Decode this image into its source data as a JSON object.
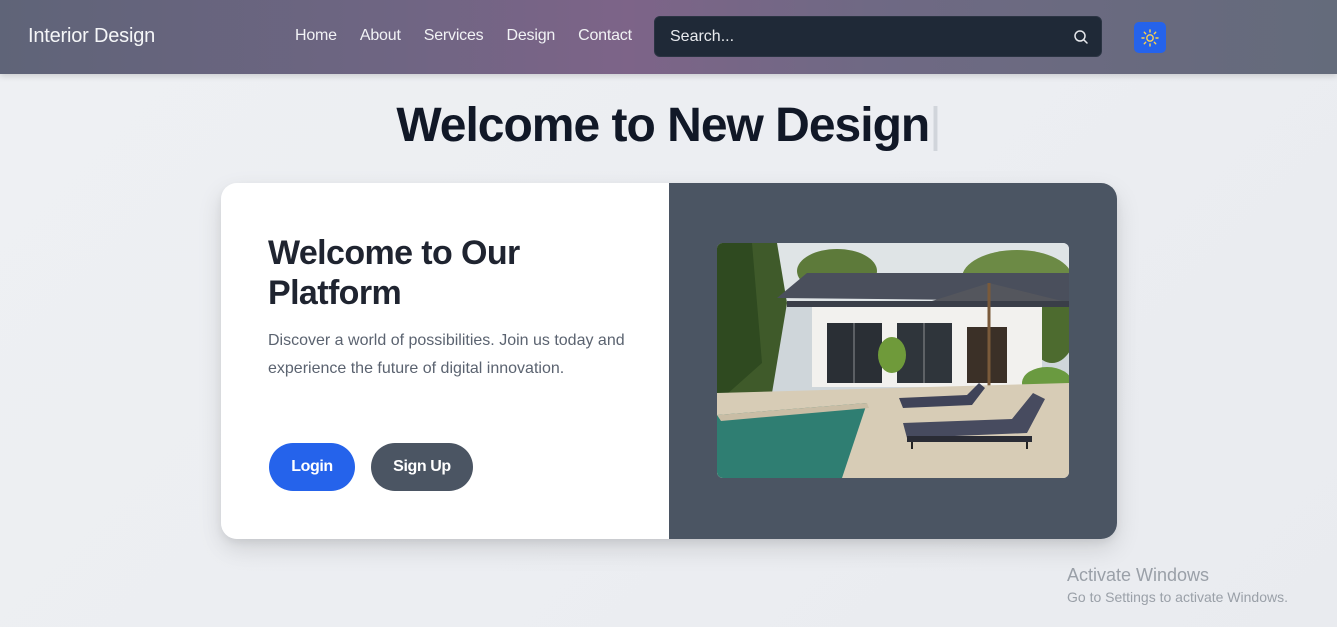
{
  "navbar": {
    "brand": "Interior Design",
    "links": [
      "Home",
      "About",
      "Services",
      "Design",
      "Contact"
    ],
    "search_placeholder": "Search...",
    "search_icon": "search-icon",
    "theme_icon": "sun-icon"
  },
  "hero": {
    "title": "Welcome to New Design",
    "cursor": "|"
  },
  "card": {
    "title": "Welcome to Our Platform",
    "text": "Discover a world of possibilities. Join us today and experience the future of digital innovation.",
    "login_label": "Login",
    "signup_label": "Sign Up"
  },
  "watermark": {
    "title": "Activate Windows",
    "subtitle": "Go to Settings to activate Windows."
  },
  "colors": {
    "accent": "#2563eb",
    "dark_panel": "#4b5563",
    "search_bg": "#1f2937"
  }
}
